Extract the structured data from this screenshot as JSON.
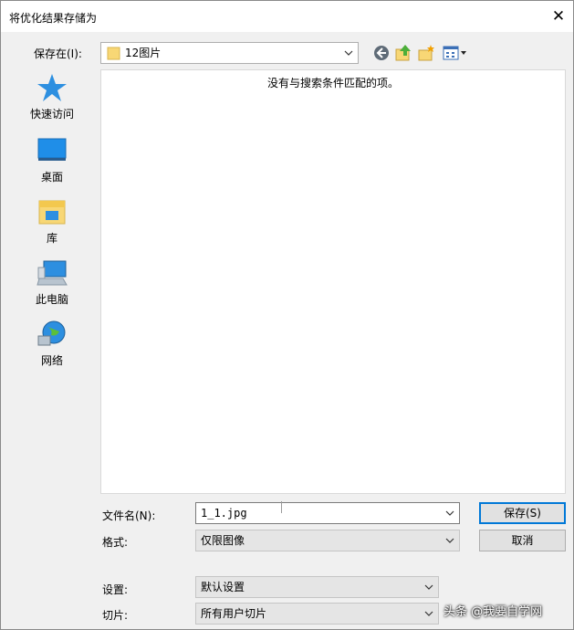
{
  "window": {
    "title": "将优化结果存储为",
    "close_glyph": "✕"
  },
  "toolbar": {
    "save_in_label": "保存在(I):",
    "save_in_value": "12图片",
    "icons": [
      "back-icon",
      "up-folder-icon",
      "new-folder-icon",
      "view-menu-icon"
    ]
  },
  "places": [
    {
      "id": "quick-access",
      "label": "快速访问",
      "icon": "star-icon"
    },
    {
      "id": "desktop",
      "label": "桌面",
      "icon": "desktop-icon"
    },
    {
      "id": "library",
      "label": "库",
      "icon": "library-icon"
    },
    {
      "id": "this-pc",
      "label": "此电脑",
      "icon": "computer-icon"
    },
    {
      "id": "network",
      "label": "网络",
      "icon": "network-icon"
    }
  ],
  "file_list": {
    "empty_message": "没有与搜索条件匹配的项。"
  },
  "form": {
    "filename_label": "文件名(N):",
    "filename_value": "1_1.jpg",
    "format_label": "格式:",
    "format_value": "仅限图像",
    "settings_label": "设置:",
    "settings_value": "默认设置",
    "slices_label": "切片:",
    "slices_value": "所有用户切片"
  },
  "buttons": {
    "save": "保存(S)",
    "cancel": "取消"
  },
  "watermark": "头条 @我要自学网",
  "colors": {
    "accent": "#0078d7",
    "folder": "#f8d775",
    "dialog_bg": "#f0f0f0"
  }
}
